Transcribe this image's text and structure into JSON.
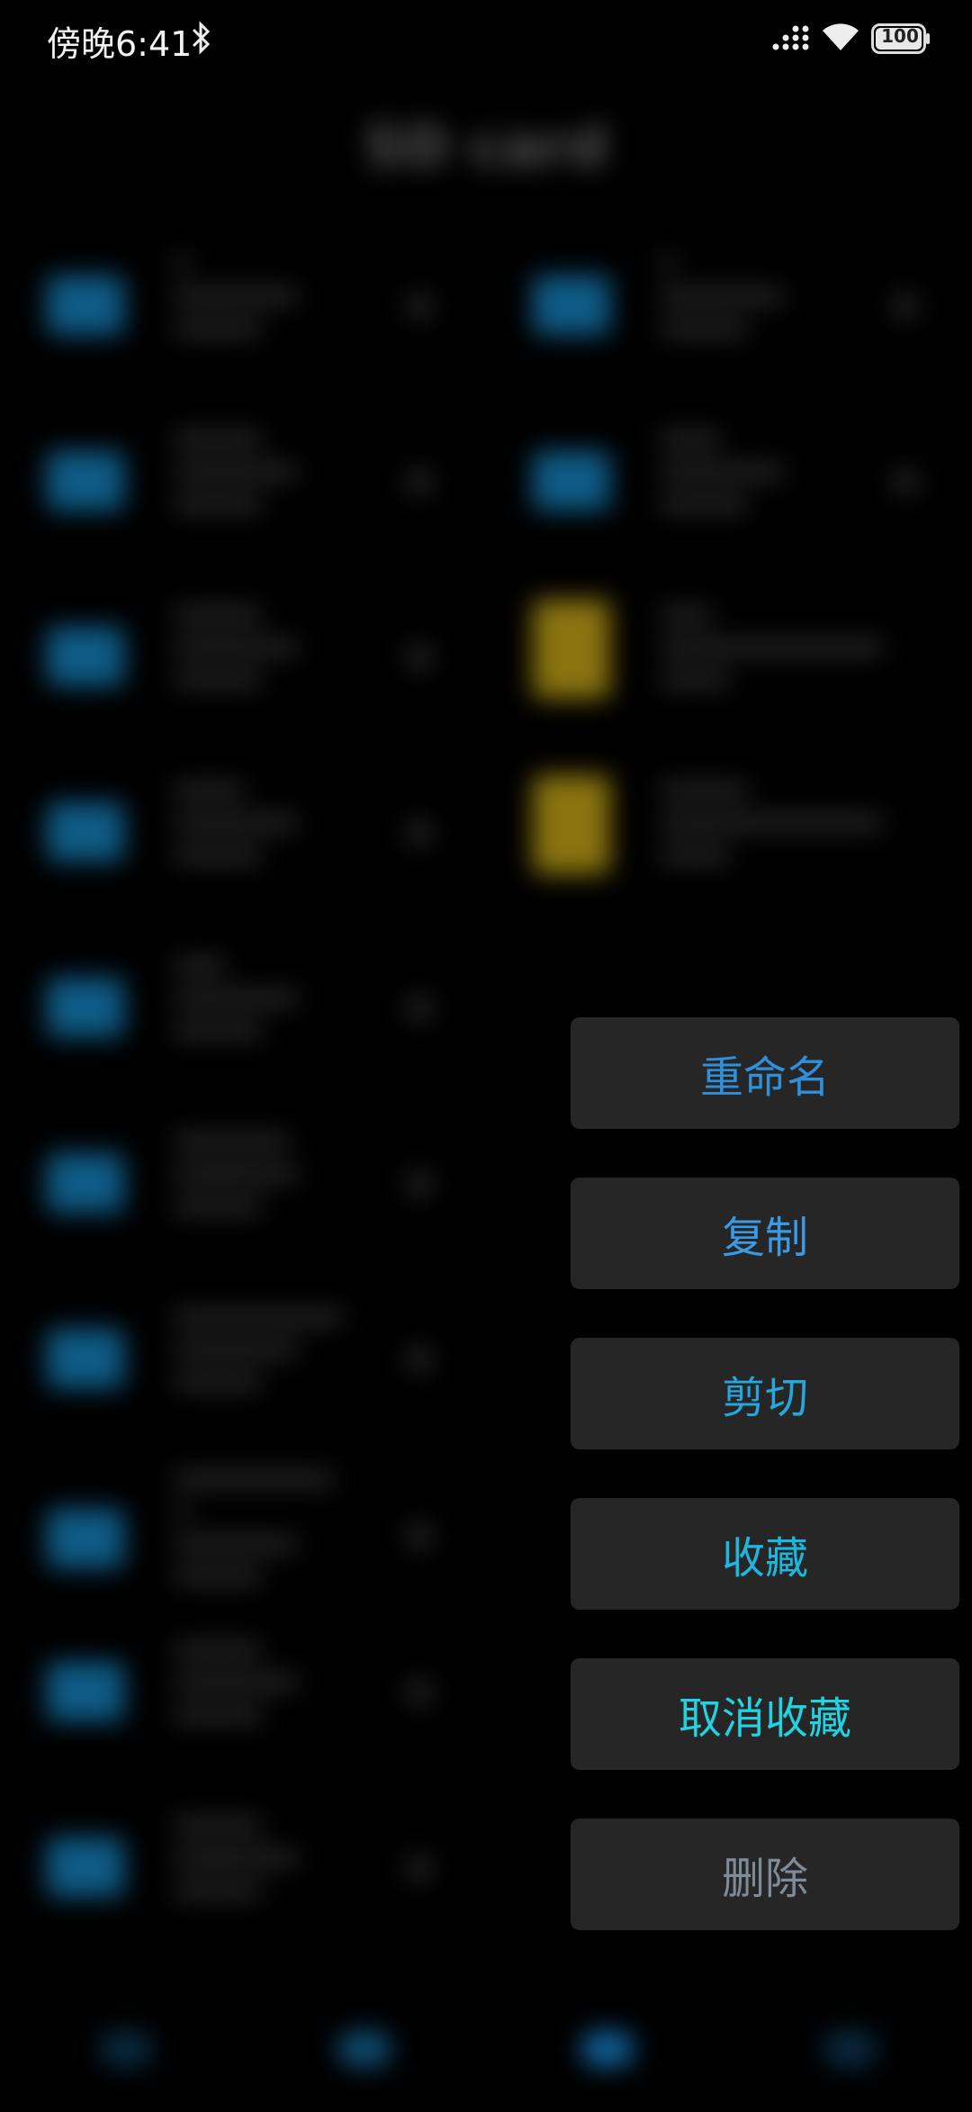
{
  "status_bar": {
    "time": "傍晚6:41",
    "battery": "100"
  },
  "background": {
    "title": "SD card"
  },
  "context_menu": {
    "items": [
      {
        "label": "重命名",
        "color": "#2f8fd8"
      },
      {
        "label": "复制",
        "color": "#3a9ae6"
      },
      {
        "label": "剪切",
        "color": "#25a6dc"
      },
      {
        "label": "收藏",
        "color": "#1fb6dd"
      },
      {
        "label": "取消收藏",
        "color": "#22d2e0"
      },
      {
        "label": "删除",
        "color": "#7e8c99"
      }
    ]
  },
  "colors": {
    "background": "#000000",
    "menu_bg": "#262626",
    "folder": "#0e5b86",
    "document": "#8a7410"
  }
}
